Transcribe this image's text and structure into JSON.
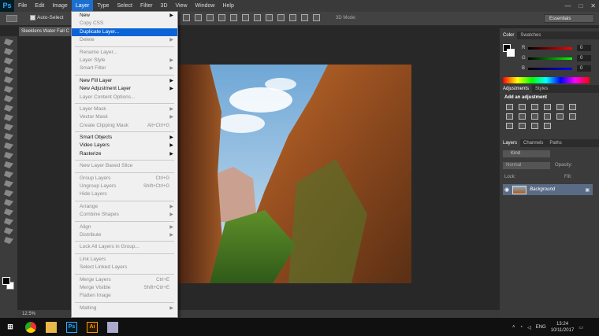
{
  "app": {
    "logo": "Ps"
  },
  "menubar": {
    "items": [
      "File",
      "Edit",
      "Image",
      "Layer",
      "Type",
      "Select",
      "Filter",
      "3D",
      "View",
      "Window",
      "Help"
    ]
  },
  "window_controls": {
    "minimize": "—",
    "maximize": "□",
    "close": "✕"
  },
  "options_bar": {
    "auto_select_label": "Auto-Select",
    "mode_3d": "3D Mode:",
    "workspace": "Essentials"
  },
  "document": {
    "tab": "Sleeklens Water Fall C",
    "zoom": "12.5%"
  },
  "layer_menu": {
    "items": [
      {
        "label": "New",
        "arrow": true
      },
      {
        "label": "Copy CSS",
        "disabled": true
      },
      {
        "label": "Duplicate Layer...",
        "highlighted": true
      },
      {
        "label": "Delete",
        "arrow": true,
        "disabled": true
      },
      {
        "sep": true
      },
      {
        "label": "Rename Layer...",
        "disabled": true
      },
      {
        "label": "Layer Style",
        "arrow": true,
        "disabled": true
      },
      {
        "label": "Smart Filter",
        "arrow": true,
        "disabled": true
      },
      {
        "sep": true
      },
      {
        "label": "New Fill Layer",
        "arrow": true
      },
      {
        "label": "New Adjustment Layer",
        "arrow": true
      },
      {
        "label": "Layer Content Options...",
        "disabled": true
      },
      {
        "sep": true
      },
      {
        "label": "Layer Mask",
        "arrow": true,
        "disabled": true
      },
      {
        "label": "Vector Mask",
        "arrow": true,
        "disabled": true
      },
      {
        "label": "Create Clipping Mask",
        "shortcut": "Alt+Ctrl+G",
        "disabled": true
      },
      {
        "sep": true
      },
      {
        "label": "Smart Objects",
        "arrow": true
      },
      {
        "label": "Video Layers",
        "arrow": true
      },
      {
        "label": "Rasterize",
        "arrow": true
      },
      {
        "sep": true
      },
      {
        "label": "New Layer Based Slice",
        "disabled": true
      },
      {
        "sep": true
      },
      {
        "label": "Group Layers",
        "shortcut": "Ctrl+G",
        "disabled": true
      },
      {
        "label": "Ungroup Layers",
        "shortcut": "Shift+Ctrl+G",
        "disabled": true
      },
      {
        "label": "Hide Layers",
        "disabled": true
      },
      {
        "sep": true
      },
      {
        "label": "Arrange",
        "arrow": true,
        "disabled": true
      },
      {
        "label": "Combine Shapes",
        "arrow": true,
        "disabled": true
      },
      {
        "sep": true
      },
      {
        "label": "Align",
        "arrow": true,
        "disabled": true
      },
      {
        "label": "Distribute",
        "arrow": true,
        "disabled": true
      },
      {
        "sep": true
      },
      {
        "label": "Lock All Layers in Group...",
        "disabled": true
      },
      {
        "sep": true
      },
      {
        "label": "Link Layers",
        "disabled": true
      },
      {
        "label": "Select Linked Layers",
        "disabled": true
      },
      {
        "sep": true
      },
      {
        "label": "Merge Layers",
        "shortcut": "Ctrl+E",
        "disabled": true
      },
      {
        "label": "Merge Visible",
        "shortcut": "Shift+Ctrl+E",
        "disabled": true
      },
      {
        "label": "Flatten Image",
        "disabled": true
      },
      {
        "sep": true
      },
      {
        "label": "Matting",
        "arrow": true,
        "disabled": true
      }
    ]
  },
  "color_panel": {
    "tabs": [
      "Color",
      "Swatches"
    ],
    "r_label": "R",
    "g_label": "G",
    "b_label": "B",
    "r": "0",
    "g": "0",
    "b": "0"
  },
  "adjustments_panel": {
    "tabs": [
      "Adjustments",
      "Styles"
    ],
    "title": "Add an adjustment"
  },
  "layers_panel": {
    "tabs": [
      "Layers",
      "Channels",
      "Paths"
    ],
    "kind": "Kind",
    "blend": "Normal",
    "opacity_label": "Opacity:",
    "lock_label": "Lock:",
    "fill_label": "Fill:",
    "layer_name": "Background"
  },
  "taskbar": {
    "language": "ENG",
    "time": "13:24",
    "date": "10/11/2017",
    "apps": [
      "chrome",
      "explorer",
      "Ps",
      "Ai",
      "notes"
    ]
  },
  "colors": {
    "accent": "#0a64d8",
    "ps_blue": "#31a8ff"
  }
}
